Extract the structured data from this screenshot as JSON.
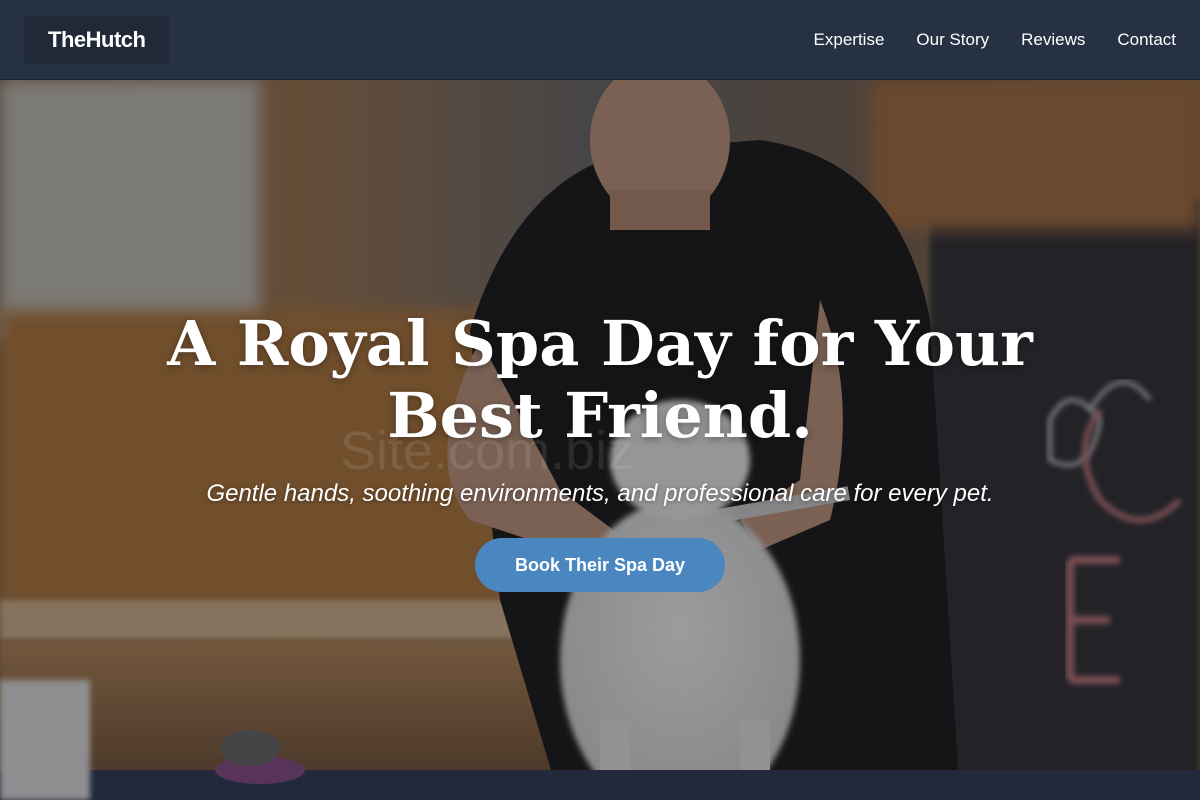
{
  "navbar": {
    "logo": "TheHutch",
    "links": [
      {
        "label": "Expertise"
      },
      {
        "label": "Our Story"
      },
      {
        "label": "Reviews"
      },
      {
        "label": "Contact"
      }
    ]
  },
  "hero": {
    "title": "A Royal Spa Day for Your Best Friend.",
    "subtitle": "Gentle hands, soothing environments, and professional care for every pet.",
    "cta_label": "Book Their Spa Day",
    "watermark": "Site.com.biz"
  },
  "colors": {
    "navbar_bg": "#263244",
    "logo_bg": "#1f2938",
    "cta_bg": "#4a86c0",
    "text": "#ffffff"
  }
}
